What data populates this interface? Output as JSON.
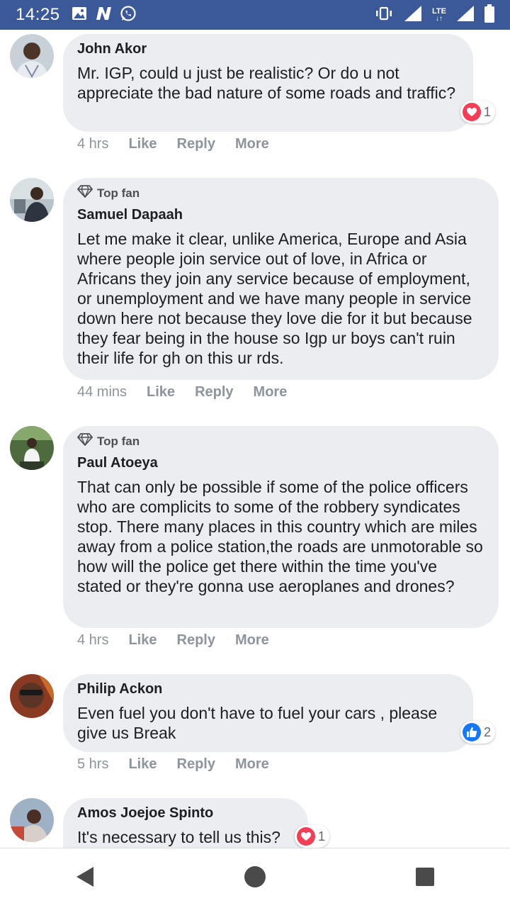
{
  "status_bar": {
    "time": "14:25",
    "network": "LTE",
    "icons": [
      "gallery-icon",
      "notification-n-icon",
      "whatsapp-icon",
      "vibrate-icon",
      "signal-icon",
      "lte-icon",
      "signal-icon",
      "battery-icon"
    ],
    "color": "#3b5998"
  },
  "comments": [
    {
      "author": "John Akor",
      "top_fan": false,
      "text": "Mr. IGP, could u just be realistic? Or do u not appreciate the bad nature of some roads and traffic?",
      "time": "4 hrs",
      "reaction": {
        "type": "love",
        "count": "1"
      }
    },
    {
      "author": "Samuel Dapaah",
      "top_fan": true,
      "badge": "Top fan",
      "text": "Let me make it clear, unlike America, Europe and Asia where people join service out of love, in Africa or Africans they join any service because of employment, or unemployment and we have many people in service down here not because they love die for it but because they fear being in the house so Igp ur boys can't ruin their life for gh on this ur rds.",
      "time": "44 mins"
    },
    {
      "author": "Paul Atoeya",
      "top_fan": true,
      "badge": "Top fan",
      "text": "That can only be possible if some of the police officers who are complicits to some of the robbery syndicates stop. There many places in this country which are miles away from a police station,the roads are unmotorable so how will the police get there within the time you've stated or they're gonna use aeroplanes and drones?",
      "time": "4 hrs"
    },
    {
      "author": "Philip Ackon",
      "top_fan": false,
      "text": "Even fuel you don't have to fuel your cars , please give us Break",
      "time": "5 hrs",
      "reaction": {
        "type": "like",
        "count": "2"
      }
    },
    {
      "author": "Amos Joejoe Spinto",
      "top_fan": false,
      "text": "It's necessary to tell us this?",
      "reaction": {
        "type": "love",
        "count": "1"
      }
    }
  ],
  "actions": {
    "like": "Like",
    "reply": "Reply",
    "more": "More"
  },
  "colors": {
    "love": "#f33e58",
    "like": "#1877f2",
    "bubble": "#ebedf0",
    "muted": "#8d949e"
  },
  "nav": [
    "back-icon",
    "home-icon",
    "recents-icon"
  ]
}
